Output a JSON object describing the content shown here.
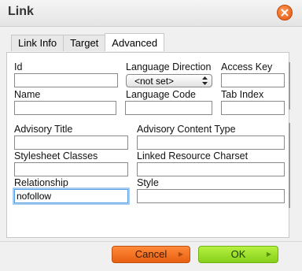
{
  "dialog": {
    "title": "Link"
  },
  "tabs": [
    {
      "label": "Link Info",
      "active": false
    },
    {
      "label": "Target",
      "active": false
    },
    {
      "label": "Advanced",
      "active": true
    }
  ],
  "fields": {
    "id": {
      "label": "Id",
      "value": ""
    },
    "language_direction": {
      "label": "Language Direction",
      "selected": "<not set>"
    },
    "access_key": {
      "label": "Access Key",
      "value": ""
    },
    "name": {
      "label": "Name",
      "value": ""
    },
    "language_code": {
      "label": "Language Code",
      "value": ""
    },
    "tab_index": {
      "label": "Tab Index",
      "value": ""
    },
    "advisory_title": {
      "label": "Advisory Title",
      "value": ""
    },
    "advisory_content_type": {
      "label": "Advisory Content Type",
      "value": ""
    },
    "stylesheet_classes": {
      "label": "Stylesheet Classes",
      "value": ""
    },
    "linked_resource_charset": {
      "label": "Linked Resource Charset",
      "value": ""
    },
    "relationship": {
      "label": "Relationship",
      "value": "nofollow"
    },
    "style": {
      "label": "Style",
      "value": ""
    }
  },
  "buttons": {
    "cancel": "Cancel",
    "ok": "OK"
  },
  "icons": {
    "close": "close-icon",
    "select_arrows": "up-down-arrows-icon",
    "button_arrow": "triangle-right-icon"
  },
  "colors": {
    "close": "#e0520a",
    "cancel": "#f07020",
    "ok": "#9ee02c",
    "focus": "#5a9fe0"
  }
}
